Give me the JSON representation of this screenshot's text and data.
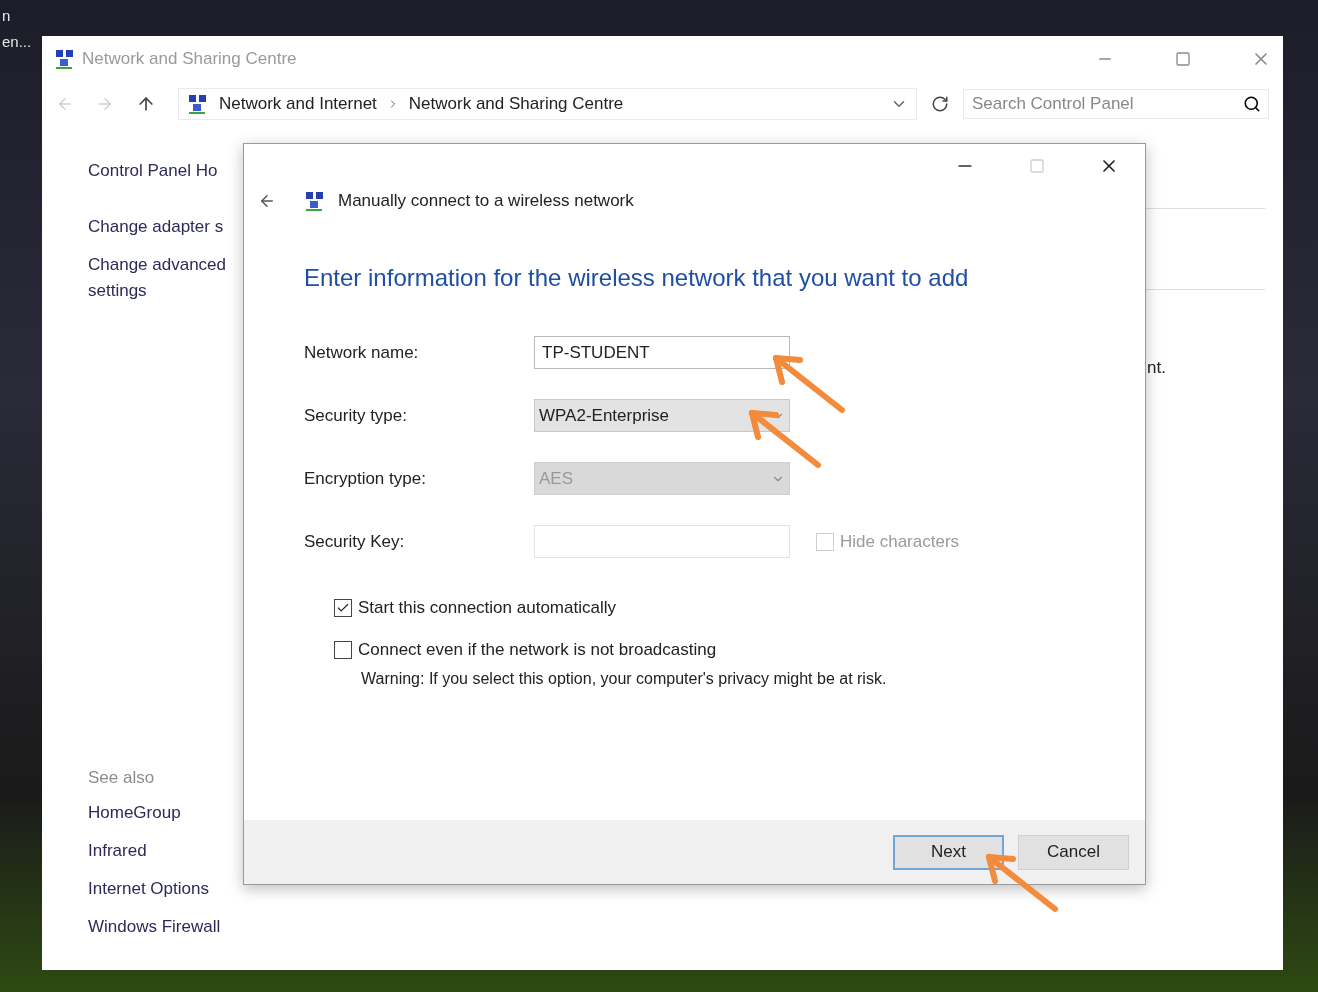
{
  "desktop": {
    "labels": [
      "n",
      "en..."
    ]
  },
  "window": {
    "title": "Network and Sharing Centre",
    "address": {
      "path": [
        "Network and Internet",
        "Network and Sharing Centre"
      ]
    },
    "search": {
      "placeholder": "Search Control Panel"
    },
    "sidebar": {
      "links": [
        "Control Panel Ho",
        "Change adapter s",
        "Change advanced settings"
      ],
      "see_also": {
        "heading": "See also",
        "links": [
          "HomeGroup",
          "Infrared",
          "Internet Options",
          "Windows Firewall"
        ]
      }
    },
    "content": {
      "fragment": "nt."
    }
  },
  "dialog": {
    "title": "Manually connect to a wireless network",
    "heading": "Enter information for the wireless network that you want to add",
    "fields": [
      {
        "kind": "text",
        "label": "Network name:",
        "value": "TP-STUDENT",
        "disabled": false,
        "arrow": true
      },
      {
        "kind": "select",
        "label": "Security type:",
        "value": "WPA2-Enterprise",
        "disabled": false,
        "arrow": true
      },
      {
        "kind": "select",
        "label": "Encryption type:",
        "value": "AES",
        "disabled": true,
        "arrow": false
      },
      {
        "kind": "text",
        "label": "Security Key:",
        "disabled": true,
        "arrow": false,
        "option": {
          "label": "Hide characters",
          "checked": false,
          "disabled": true
        }
      }
    ],
    "options": [
      {
        "label": "Start this connection automatically",
        "checked": true
      },
      {
        "label": "Connect even if the network is not broadcasting",
        "checked": false
      }
    ],
    "warning": "Warning: If you select this option, your computer's privacy might be at risk.",
    "buttons": [
      {
        "label": "Next",
        "default": true,
        "arrow": true
      },
      {
        "label": "Cancel",
        "default": false,
        "arrow": false
      }
    ]
  }
}
